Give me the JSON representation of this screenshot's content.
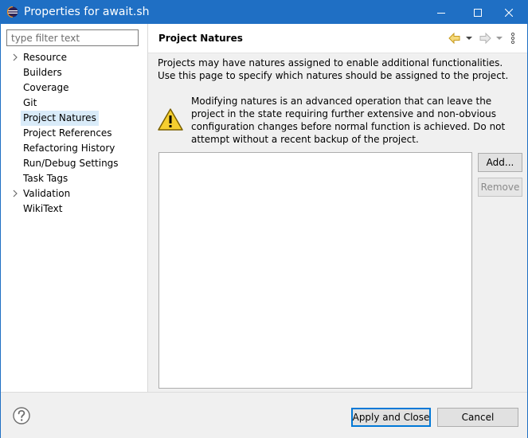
{
  "window": {
    "title": "Properties for await.sh",
    "controls": {
      "minimize": "minimize-icon",
      "maximize": "maximize-icon",
      "close": "close-icon"
    },
    "accent": "#1f6fc4"
  },
  "sidebar": {
    "filter_placeholder": "type filter text",
    "items": [
      {
        "label": "Resource",
        "expandable": true
      },
      {
        "label": "Builders",
        "expandable": false
      },
      {
        "label": "Coverage",
        "expandable": false
      },
      {
        "label": "Git",
        "expandable": false
      },
      {
        "label": "Project Natures",
        "expandable": false,
        "selected": true
      },
      {
        "label": "Project References",
        "expandable": false
      },
      {
        "label": "Refactoring History",
        "expandable": false
      },
      {
        "label": "Run/Debug Settings",
        "expandable": false
      },
      {
        "label": "Task Tags",
        "expandable": false
      },
      {
        "label": "Validation",
        "expandable": true
      },
      {
        "label": "WikiText",
        "expandable": false
      }
    ]
  },
  "page": {
    "title": "Project Natures",
    "description": "Projects may have natures assigned to enable additional functionalities. Use this page to specify which natures should be assigned to the project.",
    "warning": "Modifying natures is an advanced operation that can leave the project in the state requiring further extensive and non-obvious configuration changes before normal function is achieved. Do not attempt without a recent backup of the project.",
    "natures": [],
    "buttons": {
      "add": "Add...",
      "remove": "Remove"
    }
  },
  "footer": {
    "apply_close": "Apply and Close",
    "cancel": "Cancel"
  }
}
